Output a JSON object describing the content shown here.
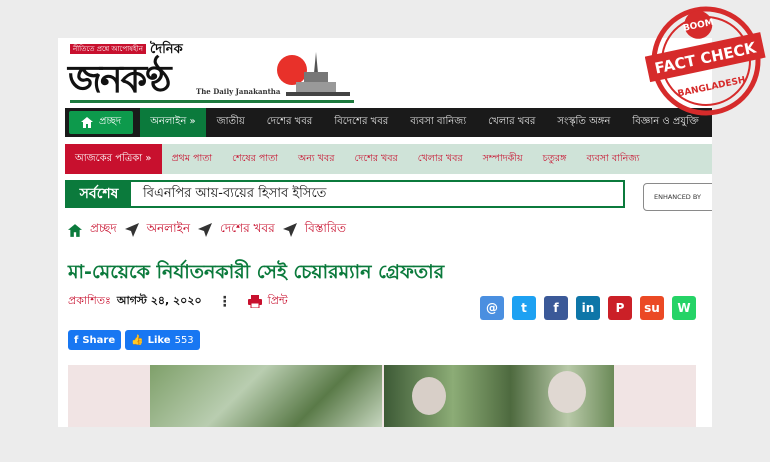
{
  "masthead": {
    "tagline": "নীতিতে প্রশ্নে আপোষহীন",
    "dainik": "দৈনিক",
    "logo": "জনকণ্ঠ",
    "english": "The Daily Janakantha"
  },
  "nav_main": {
    "home": "প্রচ্ছদ",
    "online": "অনলাইন »",
    "items": [
      "জাতীয়",
      "দেশের খবর",
      "বিদেশের খবর",
      "ব্যবসা বানিজ্য",
      "খেলার খবর",
      "সংস্কৃতি অঙ্গন",
      "বিজ্ঞান ও প্রযুক্তি"
    ]
  },
  "nav_sub": {
    "today": "আজকের পত্রিকা »",
    "items": [
      "প্রথম পাতা",
      "শেষের পাতা",
      "অন্য খবর",
      "দেশের খবর",
      "খেলার খবর",
      "সম্পাদকীয়",
      "চতুরঙ্গ",
      "ব্যবসা বানিজ্য"
    ]
  },
  "latest": {
    "tag": "সর্বশেষ",
    "text": "বিএনপির আয়-ব্যয়ের হিসাব ইসিতে"
  },
  "search": {
    "label": "ENHANCED BY"
  },
  "breadcrumb": [
    "প্রচ্ছদ",
    "অনলাইন",
    "দেশের খবর",
    "বিস্তারিত"
  ],
  "article": {
    "title": "মা-মেয়েকে নির্যাতনকারী সেই চেয়ারম্যান গ্রেফতার",
    "published_label": "প্রকাশিতঃ",
    "date": "আগস্ট ২৪, ২০২০",
    "print": "প্রিন্ট"
  },
  "share_icons": [
    {
      "name": "email-share-icon",
      "glyph": "@",
      "color": "#4a8fe0"
    },
    {
      "name": "twitter-share-icon",
      "glyph": "t",
      "color": "#1da1f2"
    },
    {
      "name": "facebook-share-icon",
      "glyph": "f",
      "color": "#3b5998"
    },
    {
      "name": "linkedin-share-icon",
      "glyph": "in",
      "color": "#0e76a8"
    },
    {
      "name": "pinterest-share-icon",
      "glyph": "P",
      "color": "#cb2027"
    },
    {
      "name": "stumbleupon-share-icon",
      "glyph": "su",
      "color": "#eb4924"
    },
    {
      "name": "whatsapp-share-icon",
      "glyph": "W",
      "color": "#25d366"
    }
  ],
  "facebook": {
    "share": "Share",
    "like": "Like",
    "like_count": "553"
  },
  "stamp": {
    "boom": "BOOM",
    "fact_check": "FACT CHECK",
    "country": "BANGLADESH"
  },
  "colors": {
    "green": "#0b7a3c",
    "red": "#c8102e",
    "stamp_red": "#d62b2b"
  }
}
